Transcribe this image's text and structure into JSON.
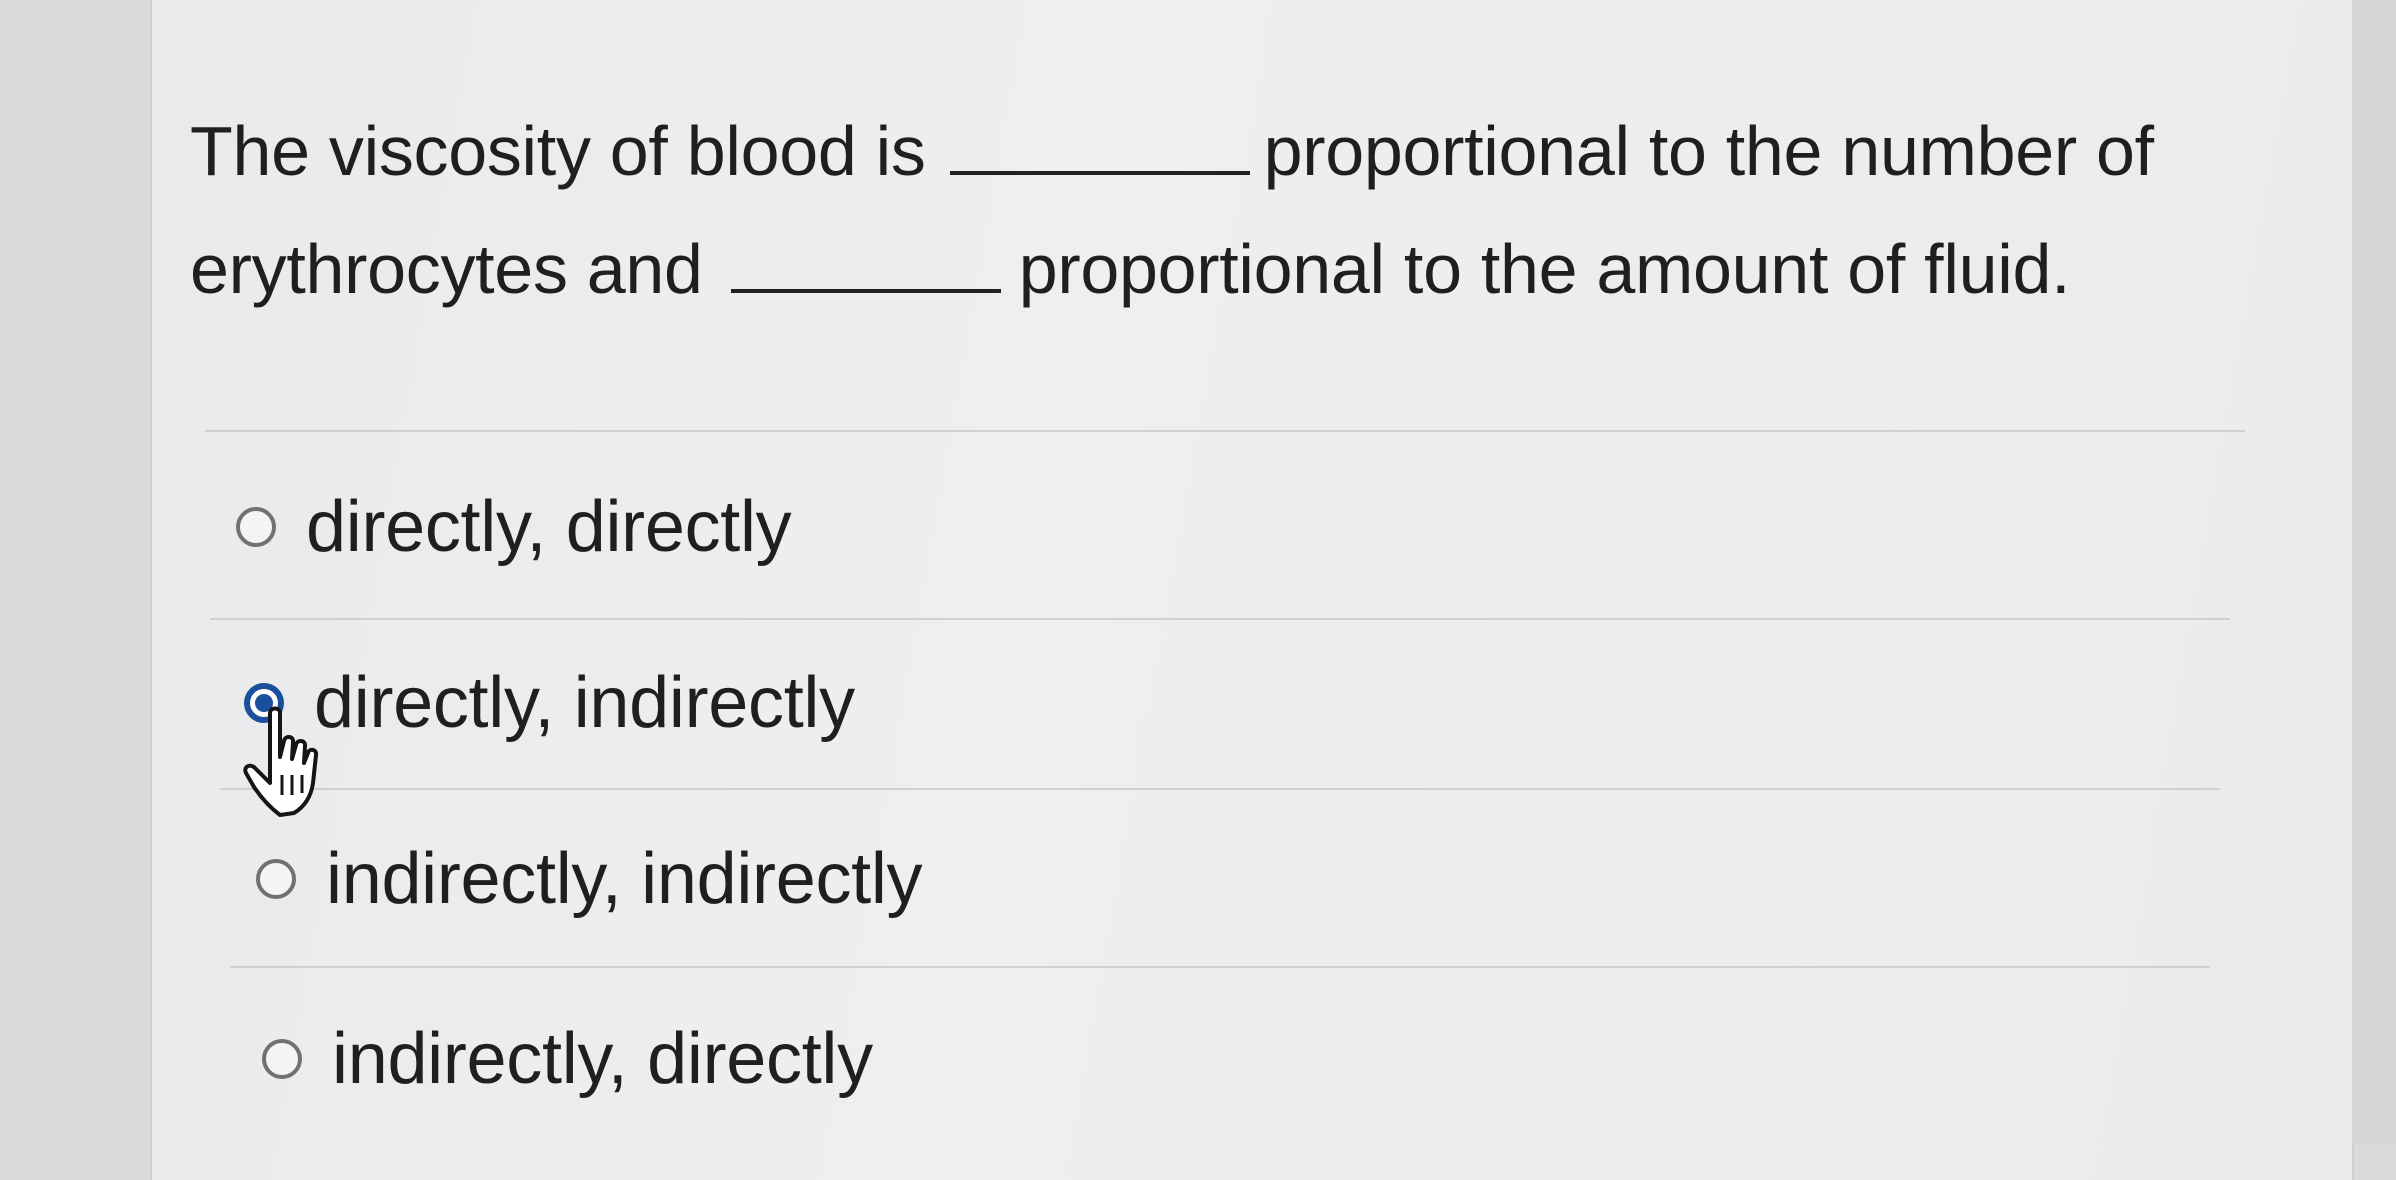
{
  "question": {
    "part1": "The viscosity of blood is",
    "part2": "proportional to the number of",
    "part3": "erythrocytes and",
    "part4": "proportional to the amount of fluid."
  },
  "options": [
    {
      "label": "directly, directly",
      "selected": false
    },
    {
      "label": "directly, indirectly",
      "selected": true
    },
    {
      "label": "indirectly, indirectly",
      "selected": false
    },
    {
      "label": "indirectly, directly",
      "selected": false
    }
  ],
  "colors": {
    "selected_radio": "#1a4f9e",
    "text": "#1f1f22"
  },
  "icons": {
    "pointer": "hand-pointer-icon"
  }
}
